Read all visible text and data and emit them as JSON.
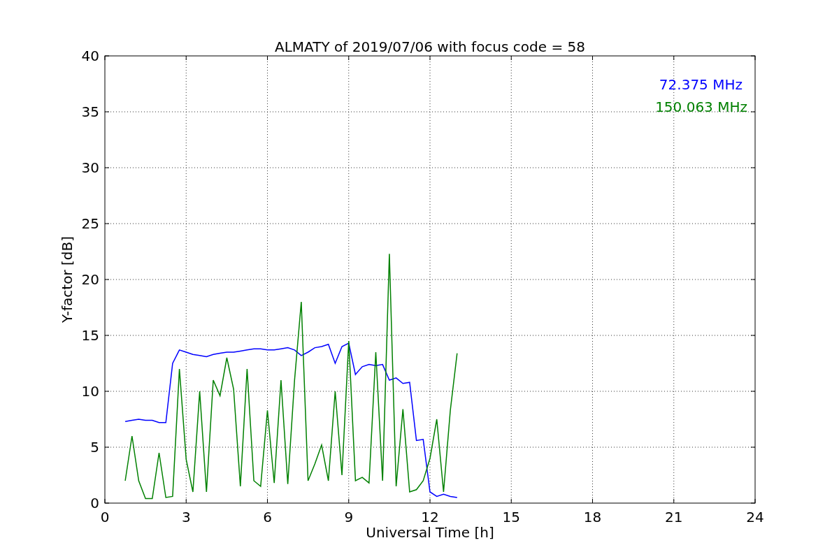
{
  "chart_data": {
    "type": "line",
    "title": "ALMATY of 2019/07/06 with focus code = 58",
    "xlabel": "Universal Time [h]",
    "ylabel": "Y-factor [dB]",
    "x": [
      0.75,
      1.0,
      1.25,
      1.5,
      1.75,
      2.0,
      2.25,
      2.5,
      2.75,
      3.0,
      3.25,
      3.5,
      3.75,
      4.0,
      4.25,
      4.5,
      4.75,
      5.0,
      5.25,
      5.5,
      5.75,
      6.0,
      6.25,
      6.5,
      6.75,
      7.0,
      7.25,
      7.5,
      7.75,
      8.0,
      8.25,
      8.5,
      8.75,
      9.0,
      9.25,
      9.5,
      9.75,
      10.0,
      10.25,
      10.5,
      10.75,
      11.0,
      11.25,
      11.5,
      11.75,
      12.0,
      12.25,
      12.5,
      12.75,
      13.0
    ],
    "series": [
      {
        "name": "72.375 MHz",
        "color": "#0000ff",
        "values": [
          7.3,
          7.4,
          7.5,
          7.4,
          7.4,
          7.2,
          7.2,
          12.5,
          13.7,
          13.5,
          13.3,
          13.2,
          13.1,
          13.3,
          13.4,
          13.5,
          13.5,
          13.6,
          13.7,
          13.8,
          13.8,
          13.7,
          13.7,
          13.8,
          13.9,
          13.7,
          13.2,
          13.5,
          13.9,
          14.0,
          14.2,
          12.5,
          14.0,
          14.3,
          11.5,
          12.2,
          12.4,
          12.3,
          12.4,
          11.0,
          11.2,
          10.7,
          10.8,
          5.6,
          5.7,
          1.0,
          0.6,
          0.8,
          0.6,
          0.5
        ]
      },
      {
        "name": "150.063 MHz",
        "color": "#008000",
        "values": [
          2.0,
          6.0,
          2.0,
          0.4,
          0.4,
          4.5,
          0.5,
          0.6,
          12.0,
          3.9,
          1.0,
          10.0,
          1.0,
          11.0,
          9.6,
          13.0,
          10.2,
          1.5,
          12.0,
          2.0,
          1.5,
          8.3,
          1.8,
          11.0,
          1.7,
          11.0,
          18.0,
          2.0,
          3.5,
          5.2,
          2.0,
          10.0,
          2.5,
          14.5,
          2.0,
          2.3,
          1.8,
          13.5,
          2.0,
          22.3,
          1.5,
          8.4,
          1.0,
          1.2,
          2.0,
          4.0,
          7.5,
          1.0,
          8.3,
          13.4
        ]
      }
    ],
    "grid": true,
    "xlim": [
      0,
      24
    ],
    "ylim": [
      0,
      40
    ],
    "xticks": [
      0,
      3,
      6,
      9,
      12,
      15,
      18,
      21,
      24
    ],
    "yticks": [
      0,
      5,
      10,
      15,
      20,
      25,
      30,
      35,
      40
    ]
  }
}
